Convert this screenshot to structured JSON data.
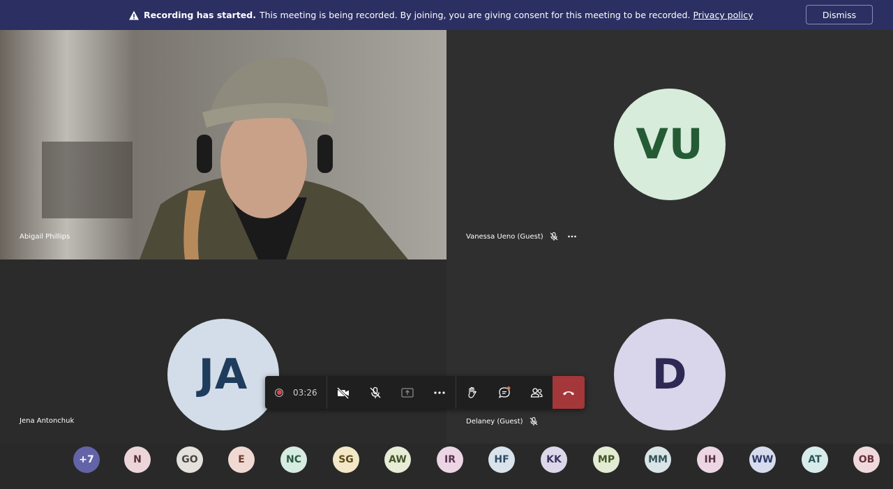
{
  "banner": {
    "title": "Recording has started.",
    "message": "This meeting is being recorded. By joining, you are giving consent for this meeting to be recorded.",
    "link": "Privacy policy",
    "dismiss": "Dismiss"
  },
  "tiles": [
    {
      "name": "Abigail Phillips"
    },
    {
      "name": "Vanessa Ueno (Guest)",
      "initials": "VU",
      "bg": "#d7ecdb",
      "fg": "#245b35"
    },
    {
      "name": "Jena Antonchuk",
      "initials": "JA",
      "bg": "#d3dde9",
      "fg": "#1f3c5c"
    },
    {
      "name": "Delaney (Guest)",
      "initials": "D",
      "bg": "#d9d5ea",
      "fg": "#2e2855"
    }
  ],
  "toolbar": {
    "timer": "03:26"
  },
  "participants": [
    {
      "initials": "+7",
      "bg": "#6264a7",
      "fg": "#ffffff"
    },
    {
      "initials": "N",
      "bg": "#ecd5d9",
      "fg": "#5a2f38"
    },
    {
      "initials": "GO",
      "bg": "#e4e1dc",
      "fg": "#4a4540"
    },
    {
      "initials": "E",
      "bg": "#f0d9d2",
      "fg": "#6a3a2c"
    },
    {
      "initials": "NC",
      "bg": "#d6ebe1",
      "fg": "#2c5a44"
    },
    {
      "initials": "SG",
      "bg": "#f2e7c6",
      "fg": "#5c4a18"
    },
    {
      "initials": "AW",
      "bg": "#e6ecd6",
      "fg": "#44532a"
    },
    {
      "initials": "IR",
      "bg": "#ecd6e6",
      "fg": "#5a2f4e"
    },
    {
      "initials": "HF",
      "bg": "#d9e3ec",
      "fg": "#2f4b62"
    },
    {
      "initials": "KK",
      "bg": "#dcd8ea",
      "fg": "#3a3460"
    },
    {
      "initials": "MP",
      "bg": "#e3ecd3",
      "fg": "#45572a"
    },
    {
      "initials": "MM",
      "bg": "#d9e4e6",
      "fg": "#35525a"
    },
    {
      "initials": "IH",
      "bg": "#ecd6e3",
      "fg": "#5a2f48"
    },
    {
      "initials": "WW",
      "bg": "#d6dcee",
      "fg": "#2e3a66"
    },
    {
      "initials": "AT",
      "bg": "#d8ecec",
      "fg": "#2c5858"
    },
    {
      "initials": "OB",
      "bg": "#f0d9dc",
      "fg": "#6a323c"
    }
  ]
}
